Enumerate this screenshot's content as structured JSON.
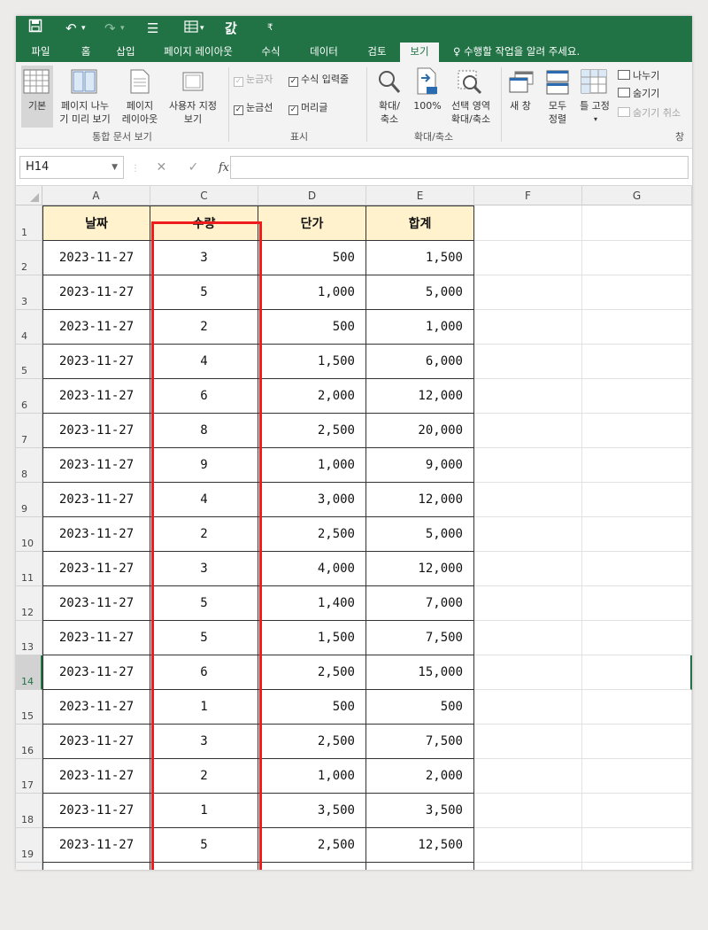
{
  "quick_access": {
    "save_icon": "save-icon",
    "undo_icon": "undo-icon",
    "redo_icon": "redo-icon",
    "touch_icon": "touch-mode-icon",
    "form_icon": "form-icon",
    "spell_label": "갌",
    "customize_icon": "customize-icon"
  },
  "tabs": [
    "파일",
    "홈",
    "삽입",
    "페이지 레이아웃",
    "수식",
    "데이터",
    "검토",
    "보기"
  ],
  "active_tab": "보기",
  "tell_me": "수행할 작업을 알려 주세요.",
  "ribbon": {
    "workbook_views": {
      "normal": "기본",
      "page_break_1": "페이지 나누",
      "page_break_2": "기 미리 보기",
      "page_layout_1": "페이지",
      "page_layout_2": "레이아웃",
      "custom_1": "사용자 지정",
      "custom_2": "보기",
      "group": "통합 문서 보기"
    },
    "show": {
      "ruler": "눈금자",
      "formula_bar": "수식 입력줄",
      "gridlines": "눈금선",
      "headings": "머리글",
      "group": "표시"
    },
    "zoom": {
      "zoom_1": "확대/",
      "zoom_2": "축소",
      "hundred": "100%",
      "selection_1": "선택 영역",
      "selection_2": "확대/축소",
      "group": "확대/축소"
    },
    "window": {
      "new_window": "새 창",
      "arrange_1": "모두",
      "arrange_2": "정렬",
      "freeze": "틀 고정",
      "split": "나누기",
      "hide": "숨기기",
      "unhide": "숨기기 취소",
      "group": "창"
    }
  },
  "formula_bar": {
    "name_box": "H14",
    "cancel": "✕",
    "enter": "✓",
    "fx": "fx",
    "content": ""
  },
  "columns": [
    "A",
    "C",
    "D",
    "E",
    "F",
    "G"
  ],
  "table": {
    "headers": [
      "날짜",
      "수량",
      "단가",
      "합계"
    ],
    "rows": [
      {
        "num": "2",
        "date": "2023-11-27",
        "qty": "3",
        "price": "500",
        "total": "1,500"
      },
      {
        "num": "3",
        "date": "2023-11-27",
        "qty": "5",
        "price": "1,000",
        "total": "5,000"
      },
      {
        "num": "4",
        "date": "2023-11-27",
        "qty": "2",
        "price": "500",
        "total": "1,000"
      },
      {
        "num": "5",
        "date": "2023-11-27",
        "qty": "4",
        "price": "1,500",
        "total": "6,000"
      },
      {
        "num": "6",
        "date": "2023-11-27",
        "qty": "6",
        "price": "2,000",
        "total": "12,000"
      },
      {
        "num": "7",
        "date": "2023-11-27",
        "qty": "8",
        "price": "2,500",
        "total": "20,000"
      },
      {
        "num": "8",
        "date": "2023-11-27",
        "qty": "9",
        "price": "1,000",
        "total": "9,000"
      },
      {
        "num": "9",
        "date": "2023-11-27",
        "qty": "4",
        "price": "3,000",
        "total": "12,000"
      },
      {
        "num": "10",
        "date": "2023-11-27",
        "qty": "2",
        "price": "2,500",
        "total": "5,000"
      },
      {
        "num": "11",
        "date": "2023-11-27",
        "qty": "3",
        "price": "4,000",
        "total": "12,000"
      },
      {
        "num": "12",
        "date": "2023-11-27",
        "qty": "5",
        "price": "1,400",
        "total": "7,000"
      },
      {
        "num": "13",
        "date": "2023-11-27",
        "qty": "5",
        "price": "1,500",
        "total": "7,500"
      },
      {
        "num": "14",
        "date": "2023-11-27",
        "qty": "6",
        "price": "2,500",
        "total": "15,000"
      },
      {
        "num": "15",
        "date": "2023-11-27",
        "qty": "1",
        "price": "500",
        "total": "500"
      },
      {
        "num": "16",
        "date": "2023-11-27",
        "qty": "3",
        "price": "2,500",
        "total": "7,500"
      },
      {
        "num": "17",
        "date": "2023-11-27",
        "qty": "2",
        "price": "1,000",
        "total": "2,000"
      },
      {
        "num": "18",
        "date": "2023-11-27",
        "qty": "1",
        "price": "3,500",
        "total": "3,500"
      },
      {
        "num": "19",
        "date": "2023-11-27",
        "qty": "5",
        "price": "2,500",
        "total": "12,500"
      }
    ]
  },
  "selected_row": "14",
  "colors": {
    "excel_green": "#217346",
    "header_fill": "#fff2cc",
    "highlight_border": "#ee1c1c"
  }
}
